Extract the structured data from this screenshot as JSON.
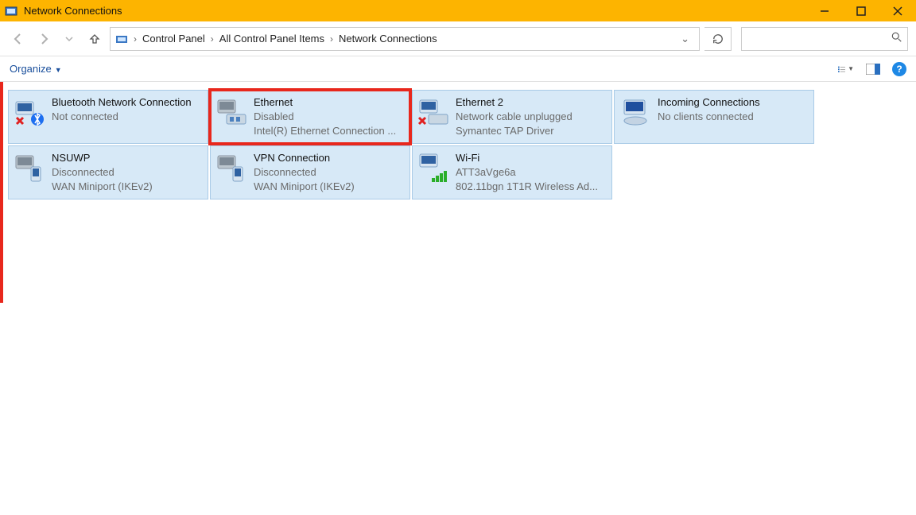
{
  "window": {
    "title": "Network Connections"
  },
  "breadcrumbs": {
    "root": "Control Panel",
    "mid": "All Control Panel Items",
    "leaf": "Network Connections"
  },
  "toolbar": {
    "organize": "Organize"
  },
  "connections": {
    "c0": {
      "name": "Bluetooth Network Connection",
      "status": "Not connected",
      "driver": ""
    },
    "c1": {
      "name": "Ethernet",
      "status": "Disabled",
      "driver": "Intel(R) Ethernet Connection ..."
    },
    "c2": {
      "name": "Ethernet 2",
      "status": "Network cable unplugged",
      "driver": "Symantec TAP Driver"
    },
    "c3": {
      "name": "Incoming Connections",
      "status": "No clients connected",
      "driver": ""
    },
    "c4": {
      "name": "NSUWP",
      "status": "Disconnected",
      "driver": "WAN Miniport (IKEv2)"
    },
    "c5": {
      "name": "VPN Connection",
      "status": "Disconnected",
      "driver": "WAN Miniport (IKEv2)"
    },
    "c6": {
      "name": "Wi-Fi",
      "status": "ATT3aVge6a",
      "driver": "802.11bgn 1T1R Wireless Ad..."
    }
  }
}
